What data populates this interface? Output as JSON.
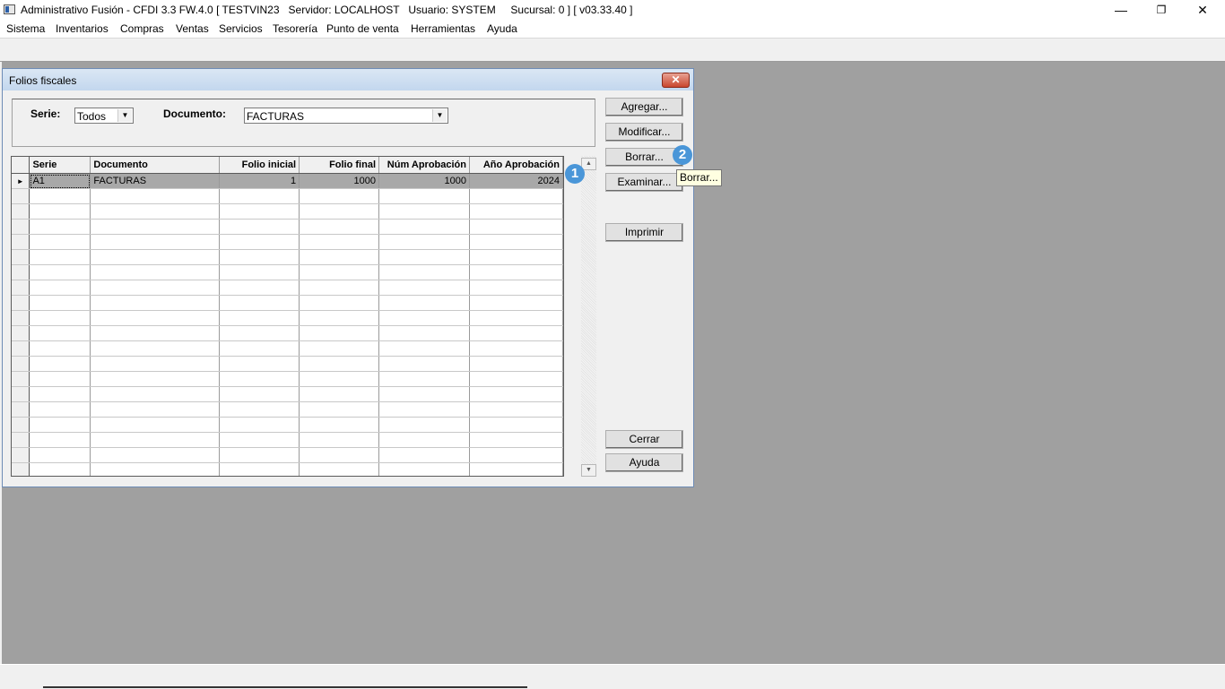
{
  "window": {
    "title": "Administrativo Fusión - CFDI 3.3 FW.4.0 [ TESTVIN23   Servidor: LOCALHOST   Usuario: SYSTEM     Sucursal: 0 ] [ v03.33.40 ]",
    "controls": {
      "minimize": "—",
      "restore": "❐",
      "close": "✕"
    }
  },
  "menu": [
    "Sistema",
    "Inventarios",
    "Compras",
    "Ventas",
    "Servicios",
    "Tesorería",
    "Punto de venta",
    "Herramientas",
    "Ayuda"
  ],
  "dialog": {
    "title": "Folios fiscales",
    "close_glyph": "✕",
    "filters": {
      "serie_label": "Serie:",
      "serie_value": "Todos",
      "documento_label": "Documento:",
      "documento_value": "FACTURAS"
    },
    "grid": {
      "columns": [
        "Serie",
        "Documento",
        "Folio inicial",
        "Folio final",
        "Núm Aprobación",
        "Año Aprobación"
      ],
      "rows": [
        {
          "serie": "A1",
          "documento": "FACTURAS",
          "folio_inicial": "1",
          "folio_final": "1000",
          "num_aprobacion": "1000",
          "anio_aprobacion": "2024"
        }
      ],
      "row_indicator": "►"
    },
    "buttons": {
      "agregar": "Agregar...",
      "modificar": "Modificar...",
      "borrar": "Borrar...",
      "examinar": "Examinar...",
      "imprimir": "Imprimir",
      "cerrar": "Cerrar",
      "ayuda": "Ayuda"
    },
    "tooltip": "Borrar..."
  },
  "annotations": {
    "badge1": "1",
    "badge2": "2"
  },
  "colors": {
    "badge": "#4a96d8",
    "mdi_background": "#a0a0a0",
    "selected_row": "#a8a8a8",
    "tooltip": "#ffffe1"
  }
}
